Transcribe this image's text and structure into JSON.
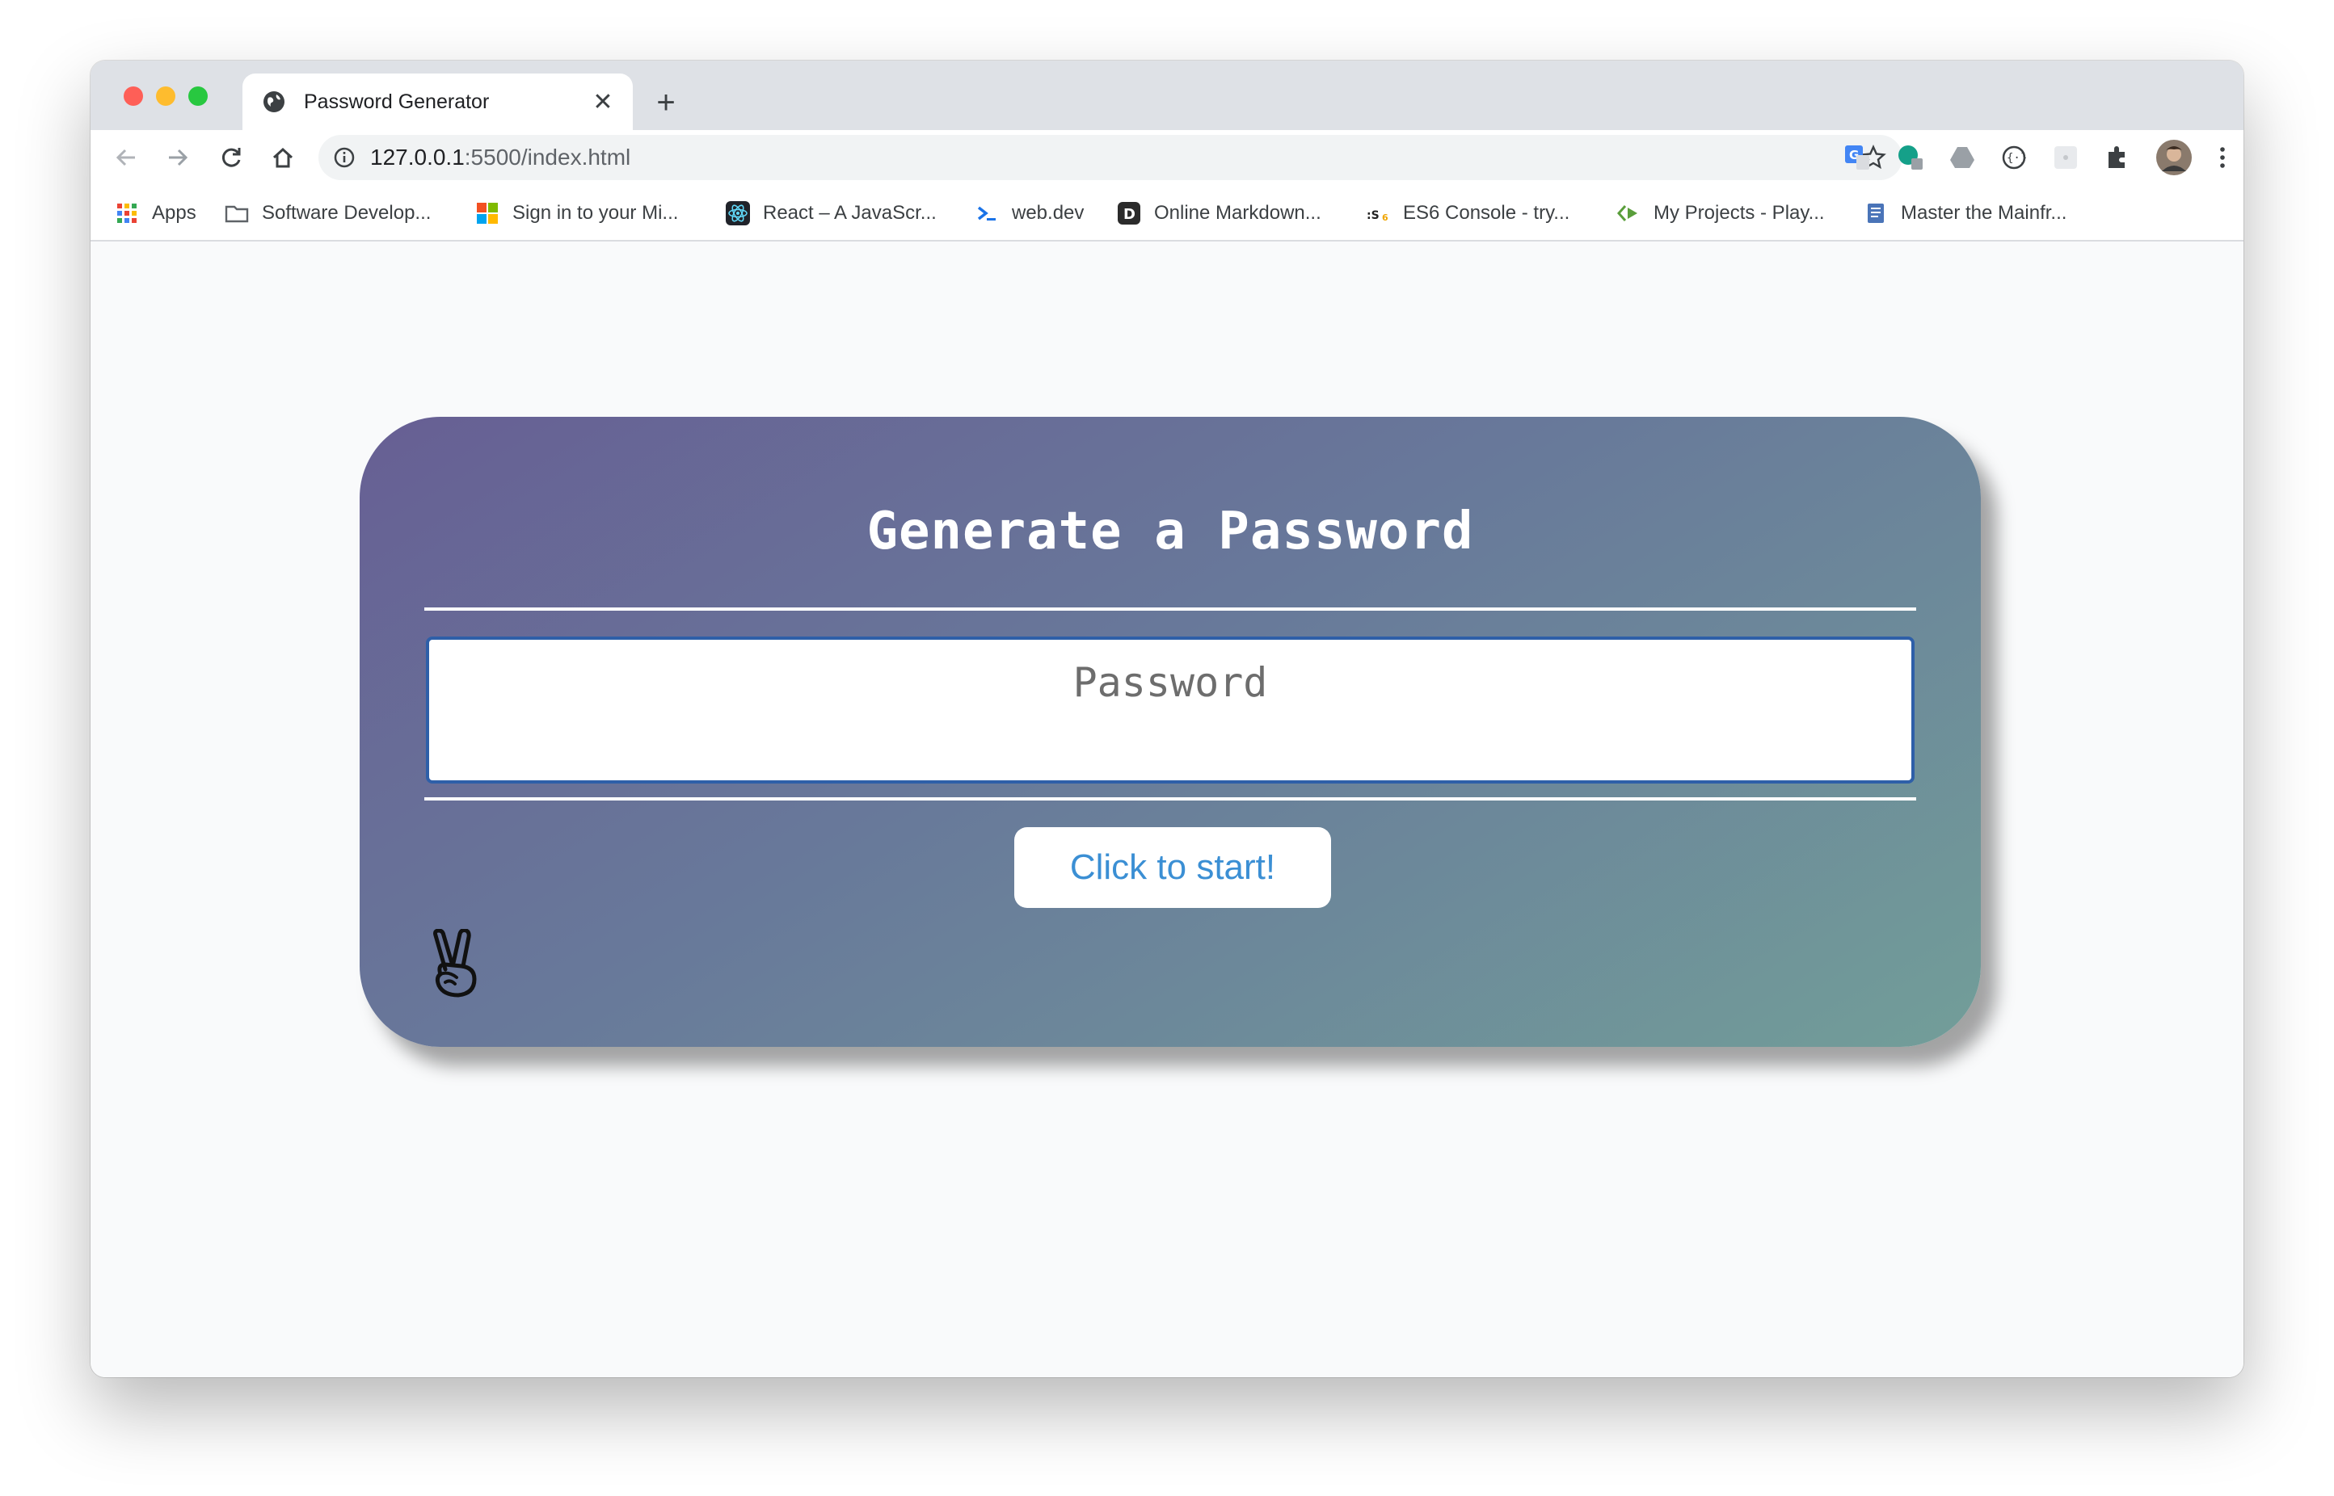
{
  "tab": {
    "title": "Password Generator"
  },
  "address_bar": {
    "host": "127.0.0.1",
    "rest": ":5500/index.html"
  },
  "bookmarks": [
    {
      "label": "Apps",
      "icon": "apps-grid-icon"
    },
    {
      "label": "Software Develop...",
      "icon": "folder-icon"
    },
    {
      "label": "Sign in to your Mi...",
      "icon": "microsoft-icon"
    },
    {
      "label": "React – A JavaScr...",
      "icon": "react-icon"
    },
    {
      "label": "web.dev",
      "icon": "webdev-icon"
    },
    {
      "label": "Online Markdown...",
      "icon": "dillinger-icon"
    },
    {
      "label": "ES6 Console - try...",
      "icon": "es6-icon"
    },
    {
      "label": "My Projects - Play...",
      "icon": "playcode-icon"
    },
    {
      "label": "Master the Mainfr...",
      "icon": "doc-icon"
    }
  ],
  "page": {
    "title": "Generate a Password",
    "password_placeholder": "Password",
    "start_button": "Click to start!"
  },
  "colors": {
    "card_gradient_start": "#675f94",
    "card_gradient_end": "#729e99",
    "button_text": "#3b8fd4",
    "input_border": "#2e5fa8"
  }
}
